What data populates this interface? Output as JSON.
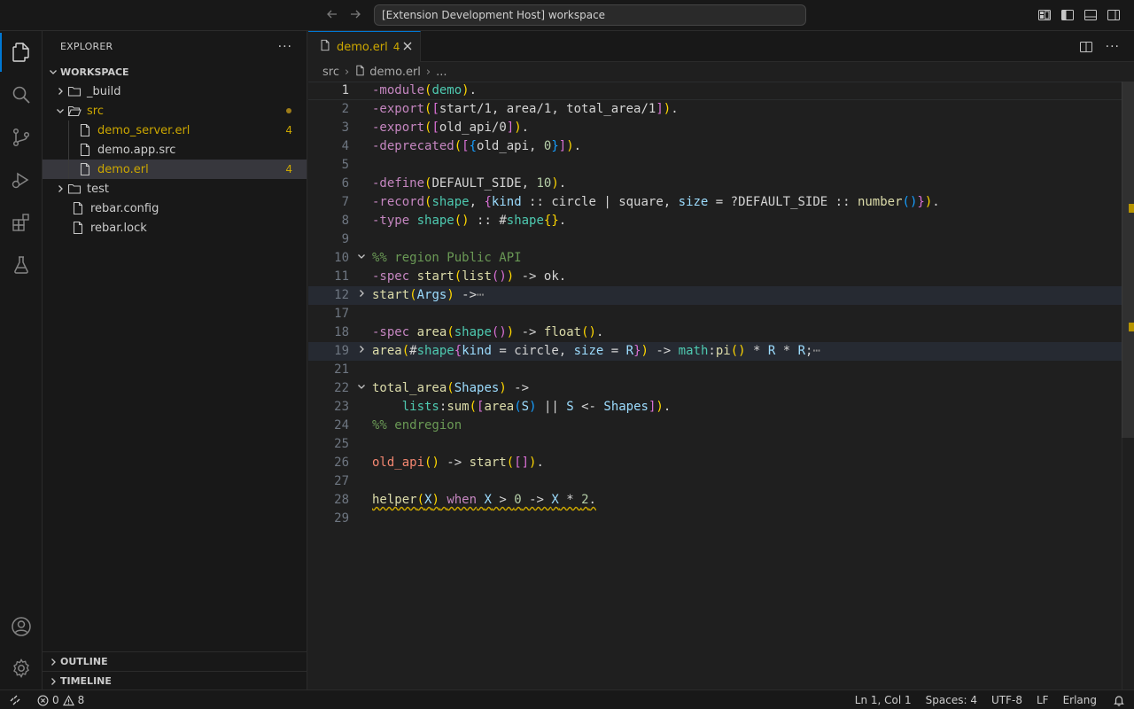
{
  "titlebar": {
    "back_icon": "arrow-left-icon",
    "forward_icon": "arrow-right-icon",
    "command_center": "[Extension Development Host] workspace"
  },
  "activity_bar": {
    "items": [
      "explorer-icon",
      "search-icon",
      "source-control-icon",
      "run-debug-icon",
      "extensions-icon",
      "testing-icon"
    ],
    "bottom": [
      "account-icon",
      "manage-gear-icon"
    ]
  },
  "sidebar": {
    "title": "EXPLORER",
    "more": "···",
    "section": "WORKSPACE",
    "tree": [
      {
        "label": "_build",
        "kind": "folder",
        "collapsed": true
      },
      {
        "label": "src",
        "kind": "folder",
        "collapsed": false
      },
      {
        "label": "demo_server.erl",
        "kind": "file",
        "badge": "4"
      },
      {
        "label": "demo.app.src",
        "kind": "file"
      },
      {
        "label": "demo.erl",
        "kind": "file",
        "badge": "4",
        "selected": true
      },
      {
        "label": "test",
        "kind": "folder",
        "collapsed": true
      },
      {
        "label": "rebar.config",
        "kind": "file"
      },
      {
        "label": "rebar.lock",
        "kind": "file"
      }
    ],
    "outline": "OUTLINE",
    "timeline": "TIMELINE"
  },
  "editor": {
    "tab": {
      "label": "demo.erl",
      "count": "4"
    },
    "breadcrumb": [
      "src",
      "demo.erl",
      "..."
    ],
    "lines": [
      {
        "n": "1",
        "text": "-module(demo)."
      },
      {
        "n": "2",
        "text": "-export([start/1, area/1, total_area/1])."
      },
      {
        "n": "3",
        "text": "-export([old_api/0])."
      },
      {
        "n": "4",
        "text": "-deprecated([{old_api, 0}])."
      },
      {
        "n": "5",
        "text": ""
      },
      {
        "n": "6",
        "text": "-define(DEFAULT_SIDE, 10)."
      },
      {
        "n": "7",
        "text": "-record(shape, {kind :: circle | square, size = ?DEFAULT_SIDE :: number()})."
      },
      {
        "n": "8",
        "text": "-type shape() :: #shape{}."
      },
      {
        "n": "9",
        "text": ""
      },
      {
        "n": "10",
        "text": "%% region Public API"
      },
      {
        "n": "11",
        "text": "-spec start(list()) -> ok."
      },
      {
        "n": "12",
        "text": "start(Args) ->"
      },
      {
        "n": "17",
        "text": ""
      },
      {
        "n": "18",
        "text": "-spec area(shape()) -> float()."
      },
      {
        "n": "19",
        "text": "area(#shape{kind = circle, size = R}) -> math:pi() * R * R;"
      },
      {
        "n": "21",
        "text": ""
      },
      {
        "n": "22",
        "text": "total_area(Shapes) ->"
      },
      {
        "n": "23",
        "text": "    lists:sum([area(S) || S <- Shapes])."
      },
      {
        "n": "24",
        "text": "%% endregion"
      },
      {
        "n": "25",
        "text": ""
      },
      {
        "n": "26",
        "text": "old_api() -> start([])."
      },
      {
        "n": "27",
        "text": ""
      },
      {
        "n": "28",
        "text": "helper(X) when X > 0 -> X * 2."
      },
      {
        "n": "29",
        "text": ""
      }
    ]
  },
  "statusbar": {
    "errors": "0",
    "warnings": "8",
    "position": "Ln 1, Col 1",
    "spaces": "Spaces: 4",
    "encoding": "UTF-8",
    "eol": "LF",
    "language": "Erlang"
  },
  "colors": {
    "accent": "#0078d4",
    "warning": "#cca700",
    "background": "#1f1f1f"
  }
}
